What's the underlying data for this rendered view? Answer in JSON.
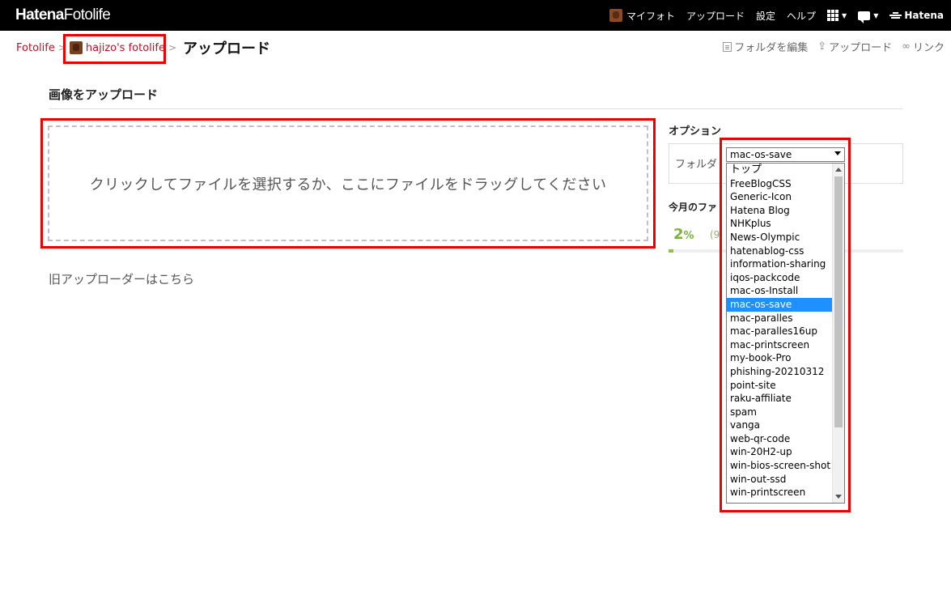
{
  "header": {
    "logo_bold": "Hatena",
    "logo_light": "Fotolife",
    "nav": {
      "my_photo": "マイフォト",
      "upload": "アップロード",
      "settings": "設定",
      "help": "ヘルプ",
      "brand": "Hatena"
    }
  },
  "breadcrumb": {
    "root": "Fotolife",
    "separator": ">",
    "user": "hajizo's fotolife",
    "current": "アップロード"
  },
  "actions": {
    "edit_folder": "フォルダを編集",
    "upload": "アップロード",
    "link": "リンク"
  },
  "main": {
    "section_title": "画像をアップロード",
    "dropzone_text": "クリックしてファイルを選択するか、ここにファイルをドラッグしてください",
    "legacy_link": "旧アップローダーはこちら"
  },
  "sidebar": {
    "options_title": "オプション",
    "folder_label": "フォルダ",
    "selected_folder": "mac-os-save",
    "today_title": "今月のファ",
    "usage_percent_number": "2",
    "usage_percent_unit": "%",
    "usage_sub": "(9",
    "usage_fraction": 0.02
  },
  "folder_options": [
    "トップ",
    "FreeBlogCSS",
    "Generic-Icon",
    "Hatena Blog",
    "NHKplus",
    "News-Olympic",
    "hatenablog-css",
    "information-sharing",
    "iqos-packcode",
    "mac-os-Install",
    "mac-os-save",
    "mac-paralles",
    "mac-paralles16up",
    "mac-printscreen",
    "my-book-Pro",
    "phishing-20210312",
    "point-site",
    "raku-affiliate",
    "spam",
    "vanga",
    "web-qr-code",
    "win-20H2-up",
    "win-bios-screen-shot",
    "win-out-ssd",
    "win-printscreen"
  ],
  "colors": {
    "topbar": "#000000",
    "link": "#c30d23",
    "highlight": "#ee0000",
    "selected": "#1e90ff",
    "usage": "#7ab33b"
  }
}
